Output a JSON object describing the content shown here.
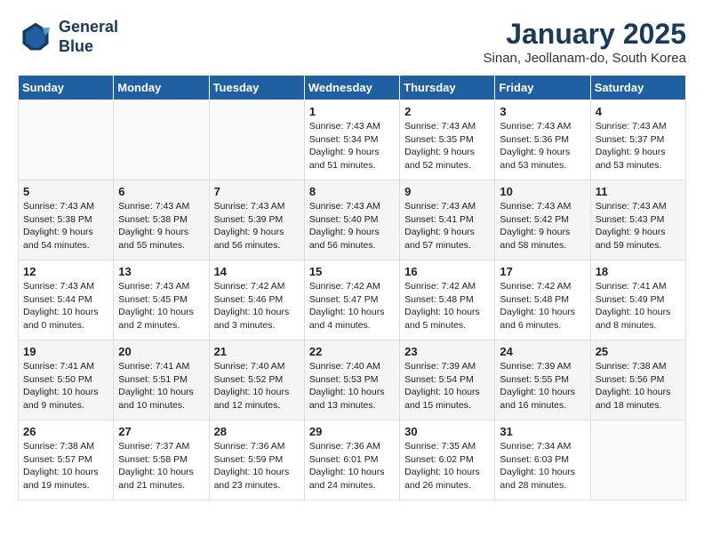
{
  "header": {
    "logo_line1": "General",
    "logo_line2": "Blue",
    "month": "January 2025",
    "location": "Sinan, Jeollanam-do, South Korea"
  },
  "weekdays": [
    "Sunday",
    "Monday",
    "Tuesday",
    "Wednesday",
    "Thursday",
    "Friday",
    "Saturday"
  ],
  "weeks": [
    [
      {
        "day": "",
        "content": ""
      },
      {
        "day": "",
        "content": ""
      },
      {
        "day": "",
        "content": ""
      },
      {
        "day": "1",
        "content": "Sunrise: 7:43 AM\nSunset: 5:34 PM\nDaylight: 9 hours\nand 51 minutes."
      },
      {
        "day": "2",
        "content": "Sunrise: 7:43 AM\nSunset: 5:35 PM\nDaylight: 9 hours\nand 52 minutes."
      },
      {
        "day": "3",
        "content": "Sunrise: 7:43 AM\nSunset: 5:36 PM\nDaylight: 9 hours\nand 53 minutes."
      },
      {
        "day": "4",
        "content": "Sunrise: 7:43 AM\nSunset: 5:37 PM\nDaylight: 9 hours\nand 53 minutes."
      }
    ],
    [
      {
        "day": "5",
        "content": "Sunrise: 7:43 AM\nSunset: 5:38 PM\nDaylight: 9 hours\nand 54 minutes."
      },
      {
        "day": "6",
        "content": "Sunrise: 7:43 AM\nSunset: 5:38 PM\nDaylight: 9 hours\nand 55 minutes."
      },
      {
        "day": "7",
        "content": "Sunrise: 7:43 AM\nSunset: 5:39 PM\nDaylight: 9 hours\nand 56 minutes."
      },
      {
        "day": "8",
        "content": "Sunrise: 7:43 AM\nSunset: 5:40 PM\nDaylight: 9 hours\nand 56 minutes."
      },
      {
        "day": "9",
        "content": "Sunrise: 7:43 AM\nSunset: 5:41 PM\nDaylight: 9 hours\nand 57 minutes."
      },
      {
        "day": "10",
        "content": "Sunrise: 7:43 AM\nSunset: 5:42 PM\nDaylight: 9 hours\nand 58 minutes."
      },
      {
        "day": "11",
        "content": "Sunrise: 7:43 AM\nSunset: 5:43 PM\nDaylight: 9 hours\nand 59 minutes."
      }
    ],
    [
      {
        "day": "12",
        "content": "Sunrise: 7:43 AM\nSunset: 5:44 PM\nDaylight: 10 hours\nand 0 minutes."
      },
      {
        "day": "13",
        "content": "Sunrise: 7:43 AM\nSunset: 5:45 PM\nDaylight: 10 hours\nand 2 minutes."
      },
      {
        "day": "14",
        "content": "Sunrise: 7:42 AM\nSunset: 5:46 PM\nDaylight: 10 hours\nand 3 minutes."
      },
      {
        "day": "15",
        "content": "Sunrise: 7:42 AM\nSunset: 5:47 PM\nDaylight: 10 hours\nand 4 minutes."
      },
      {
        "day": "16",
        "content": "Sunrise: 7:42 AM\nSunset: 5:48 PM\nDaylight: 10 hours\nand 5 minutes."
      },
      {
        "day": "17",
        "content": "Sunrise: 7:42 AM\nSunset: 5:48 PM\nDaylight: 10 hours\nand 6 minutes."
      },
      {
        "day": "18",
        "content": "Sunrise: 7:41 AM\nSunset: 5:49 PM\nDaylight: 10 hours\nand 8 minutes."
      }
    ],
    [
      {
        "day": "19",
        "content": "Sunrise: 7:41 AM\nSunset: 5:50 PM\nDaylight: 10 hours\nand 9 minutes."
      },
      {
        "day": "20",
        "content": "Sunrise: 7:41 AM\nSunset: 5:51 PM\nDaylight: 10 hours\nand 10 minutes."
      },
      {
        "day": "21",
        "content": "Sunrise: 7:40 AM\nSunset: 5:52 PM\nDaylight: 10 hours\nand 12 minutes."
      },
      {
        "day": "22",
        "content": "Sunrise: 7:40 AM\nSunset: 5:53 PM\nDaylight: 10 hours\nand 13 minutes."
      },
      {
        "day": "23",
        "content": "Sunrise: 7:39 AM\nSunset: 5:54 PM\nDaylight: 10 hours\nand 15 minutes."
      },
      {
        "day": "24",
        "content": "Sunrise: 7:39 AM\nSunset: 5:55 PM\nDaylight: 10 hours\nand 16 minutes."
      },
      {
        "day": "25",
        "content": "Sunrise: 7:38 AM\nSunset: 5:56 PM\nDaylight: 10 hours\nand 18 minutes."
      }
    ],
    [
      {
        "day": "26",
        "content": "Sunrise: 7:38 AM\nSunset: 5:57 PM\nDaylight: 10 hours\nand 19 minutes."
      },
      {
        "day": "27",
        "content": "Sunrise: 7:37 AM\nSunset: 5:58 PM\nDaylight: 10 hours\nand 21 minutes."
      },
      {
        "day": "28",
        "content": "Sunrise: 7:36 AM\nSunset: 5:59 PM\nDaylight: 10 hours\nand 23 minutes."
      },
      {
        "day": "29",
        "content": "Sunrise: 7:36 AM\nSunset: 6:01 PM\nDaylight: 10 hours\nand 24 minutes."
      },
      {
        "day": "30",
        "content": "Sunrise: 7:35 AM\nSunset: 6:02 PM\nDaylight: 10 hours\nand 26 minutes."
      },
      {
        "day": "31",
        "content": "Sunrise: 7:34 AM\nSunset: 6:03 PM\nDaylight: 10 hours\nand 28 minutes."
      },
      {
        "day": "",
        "content": ""
      }
    ]
  ]
}
